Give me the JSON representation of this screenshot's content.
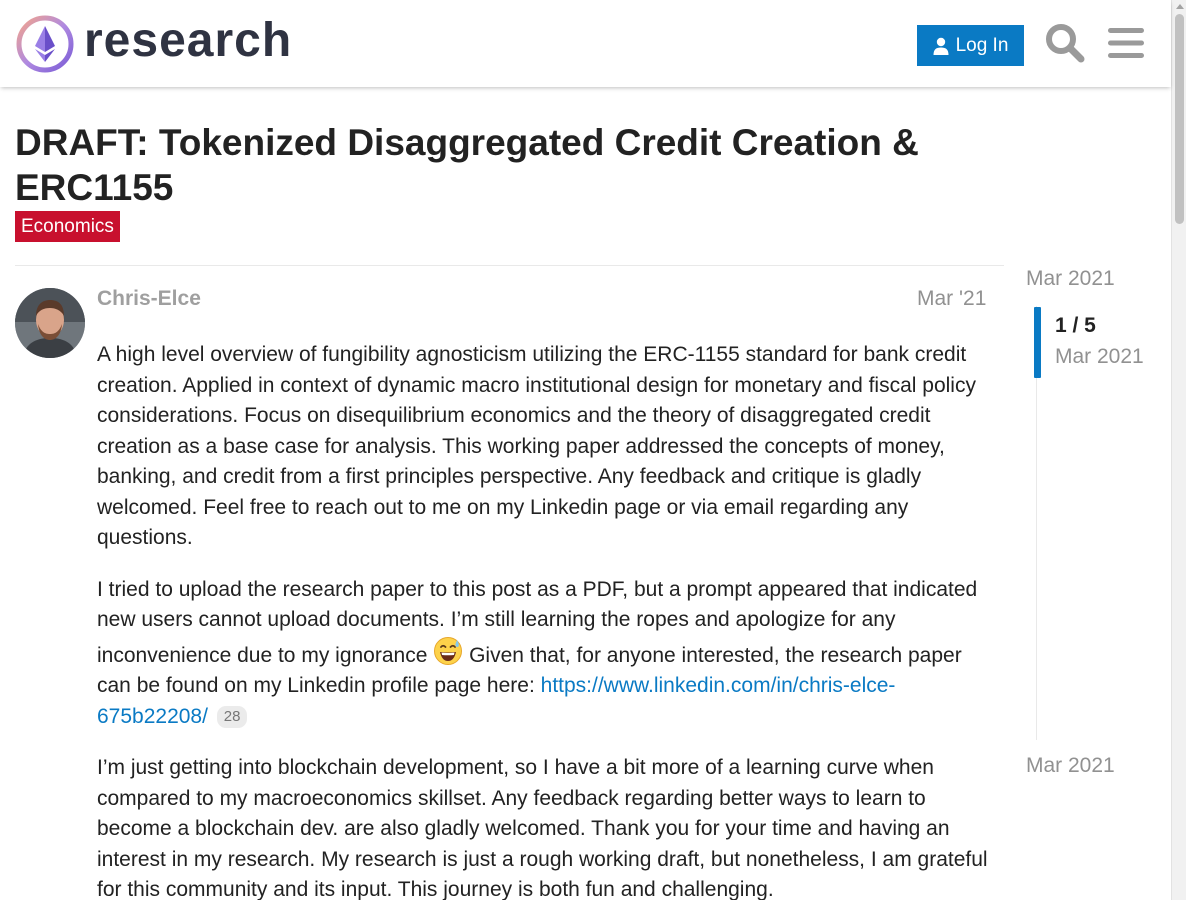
{
  "header": {
    "site_name": "research",
    "login_label": "Log In",
    "icons": [
      "logo-icon",
      "user-icon",
      "search-icon",
      "menu-icon"
    ]
  },
  "topic": {
    "title": "DRAFT: Tokenized Disaggregated Credit Creation & ERC1155",
    "category": "Economics",
    "category_color": "#c8102e"
  },
  "post": {
    "username": "Chris-Elce",
    "date": "Mar '21",
    "paragraphs": {
      "p1": "A high level overview of fungibility agnosticism utilizing the ERC-1155 standard for bank credit creation. Applied in context of dynamic macro institutional design for monetary and fiscal policy considerations. Focus on disequilibrium economics and the theory of disaggregated credit creation as a base case for analysis. This working paper addressed the concepts of money, banking, and credit from a first principles perspective. Any feedback and critique is gladly welcomed. Feel free to reach out to me on my Linkedin page or via email regarding any questions.",
      "p2_before_emoji": "I tried to upload the research paper to this post as a PDF, but a prompt appeared that indicated new users cannot upload documents. I’m still learning the ropes and apologize for any inconvenience due to my ignorance",
      "p2_after_emoji": " Given that, for anyone interested, the research paper can be found on my Linkedin profile page here: ",
      "p2_link": "https://www.linkedin.com/in/chris-elce-675b22208/",
      "p2_link_clicks": "28",
      "p3": "I’m just getting into blockchain development, so I have a bit more of a learning curve when compared to my macroeconomics skillset. Any feedback regarding better ways to learn to become a blockchain dev. are also gladly welcomed. Thank you for your time and having an interest in my research. My research is just a rough working draft, but nonetheless, I am grateful for this community and its input. This journey is both fun and challenging."
    },
    "emoji": "sweat-smile-emoji"
  },
  "timeline": {
    "start_date": "Mar 2021",
    "progress": "1 / 5",
    "handle_date": "Mar 2021",
    "end_date": "Mar 2021",
    "position_fraction": 0.2
  },
  "colors": {
    "accent": "#0a7ac4",
    "muted_text": "#919191"
  }
}
